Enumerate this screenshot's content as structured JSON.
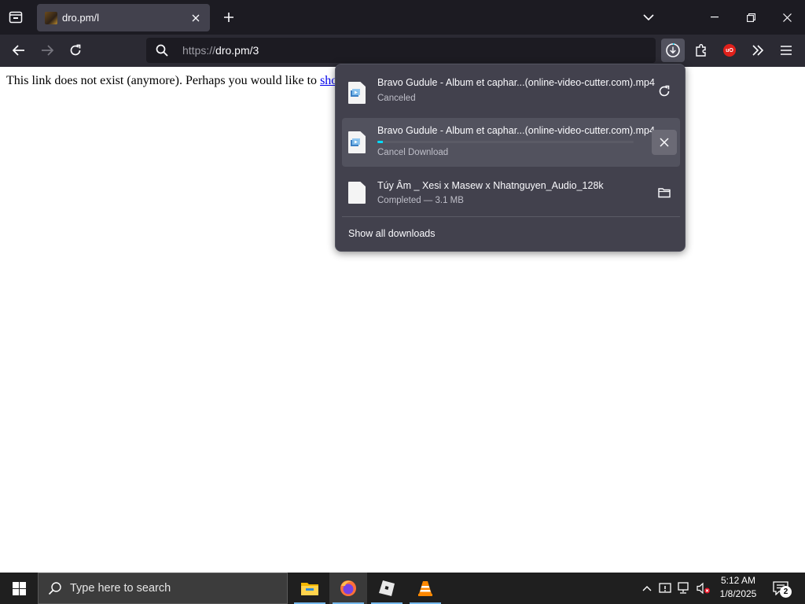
{
  "browser": {
    "tab": {
      "title": "dro.pm/l"
    },
    "url": {
      "scheme": "https://",
      "host_path": "dro.pm/3"
    }
  },
  "page": {
    "message": "This link does not exist (anymore). Perhaps you would like to ",
    "link_text": "sho"
  },
  "downloads": {
    "items": [
      {
        "name": "Bravo Gudule - Album et caphar...(online-video-cutter.com).mp4",
        "status": "Canceled",
        "action": "retry-icon"
      },
      {
        "name": "Bravo Gudule - Album et caphar...(online-video-cutter.com).mp4",
        "status": "Cancel Download",
        "action": "cancel-icon",
        "progress": 0.02
      },
      {
        "name": "Túy Âm _ Xesi x Masew x Nhatnguyen_Audio_128k",
        "status": "Completed — 3.1 MB",
        "action": "folder-icon"
      }
    ],
    "show_all": "Show all downloads"
  },
  "taskbar": {
    "search_placeholder": "Type here to search",
    "time": "5:12 AM",
    "date": "1/8/2025",
    "notification_count": "2",
    "apps": [
      "file-explorer-icon",
      "firefox-icon",
      "roblox-icon",
      "vlc-icon"
    ]
  },
  "colors": {
    "tabstrip": "#1c1b22",
    "toolbar": "#2b2a33",
    "panel": "#42414d",
    "progress": "#00ddff",
    "link": "#0000ee"
  }
}
